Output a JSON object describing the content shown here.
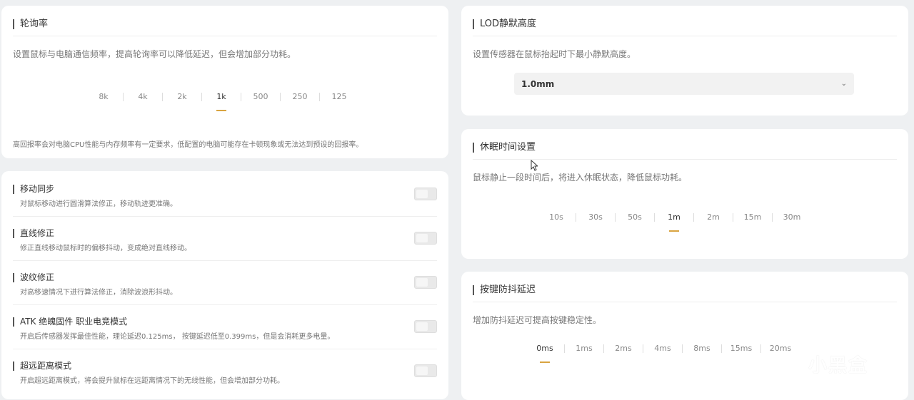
{
  "polling": {
    "title": "轮询率",
    "description": "设置鼠标与电脑通信频率，提高轮询率可以降低延迟，但会增加部分功耗。",
    "options": [
      "8k",
      "4k",
      "2k",
      "1k",
      "500",
      "250",
      "125"
    ],
    "selected": "1k",
    "note": "高回报率会对电脑CPU性能与内存频率有一定要求，低配置的电脑可能存在卡顿现象或无法达到预设的回报率。"
  },
  "features": {
    "items": [
      {
        "title": "移动同步",
        "desc": "对鼠标移动进行圆滑算法修正，移动轨迹更准确。"
      },
      {
        "title": "直线修正",
        "desc": "修正直线移动鼠标时的偏移抖动，变成绝对直线移动。"
      },
      {
        "title": "波纹修正",
        "desc": "对高移速情况下进行算法修正，消除波浪形抖动。"
      },
      {
        "title": "ATK 绝魄固件 职业电竞模式",
        "desc": "开启后传感器发挥最佳性能，理论延迟0.125ms， 按键延迟低至0.399ms，但是会消耗更多电量。"
      },
      {
        "title": "超远距离模式",
        "desc": "开启超远距离模式，将会提升鼠标在远距离情况下的无线性能，但会增加部分功耗。"
      }
    ]
  },
  "lod": {
    "title": "LOD静默高度",
    "description": "设置传感器在鼠标抬起时下最小静默高度。",
    "value": "1.0mm"
  },
  "sleep": {
    "title": "休眠时间设置",
    "description": "鼠标静止一段时间后，将进入休眠状态，降低鼠标功耗。",
    "options": [
      "10s",
      "30s",
      "50s",
      "1m",
      "2m",
      "15m",
      "30m"
    ],
    "selected": "1m"
  },
  "debounce": {
    "title": "按键防抖延迟",
    "description": "增加防抖延迟可提高按键稳定性。",
    "options": [
      "0ms",
      "1ms",
      "2ms",
      "4ms",
      "8ms",
      "15ms",
      "20ms"
    ],
    "selected": "0ms"
  },
  "watermark": {
    "text": "小黑盒"
  },
  "colors": {
    "accent": "#d9a441",
    "background": "#eef0f2",
    "card": "#ffffff"
  }
}
